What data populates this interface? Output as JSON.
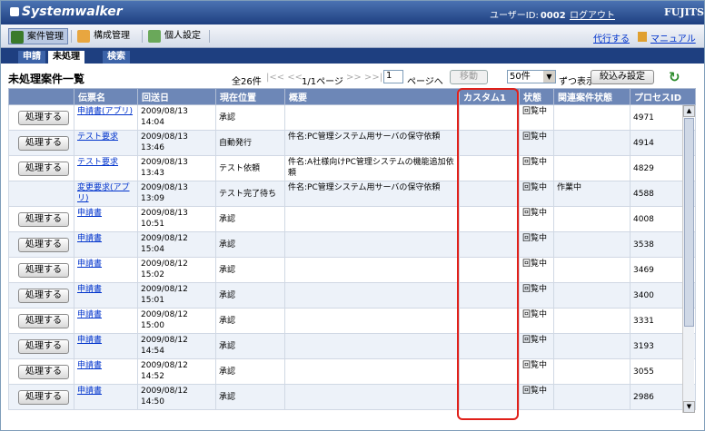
{
  "app": {
    "brand": "Systemwalker",
    "user_label": "ユーザーID:",
    "user_id": "0002",
    "logout": "ログアウト",
    "vendor": "FUJITSU"
  },
  "menu": {
    "case": "案件管理",
    "config": "構成管理",
    "personal": "個人設定",
    "proxy": "代行する",
    "manual": "マニュアル"
  },
  "tabs": {
    "apply": "申請",
    "pending": "未処理",
    "search": "検索"
  },
  "list": {
    "title": "未処理案件一覧",
    "total": "全26件",
    "pager_first": "|<< <<",
    "pageinfo": "1/1ページ",
    "pager_next": ">> >>|",
    "page_value": "1",
    "page_suffix": "ページへ",
    "move": "移動",
    "count": "50件",
    "count_suffix": "ずつ表示",
    "filter": "絞込み設定"
  },
  "columns": [
    "",
    "伝票名",
    "回送日",
    "現在位置",
    "概要",
    "カスタム1",
    "状態",
    "関連案件状態",
    "プロセスID"
  ],
  "rows": [
    {
      "btn": "処理する",
      "slip": "申請書(アプリ)",
      "date": "2009/08/13 14:04",
      "pos": "承認",
      "summary": "",
      "custom": "",
      "status": "回覧中",
      "rel": "",
      "pid": "4971"
    },
    {
      "btn": "処理する",
      "slip": "テスト要求",
      "date": "2009/08/13 13:46",
      "pos": "自動発行",
      "summary": "件名:PC管理システム用サーバの保守依頼",
      "custom": "",
      "status": "回覧中",
      "rel": "",
      "pid": "4914"
    },
    {
      "btn": "処理する",
      "slip": "テスト要求",
      "date": "2009/08/13 13:43",
      "pos": "テスト依頼",
      "summary": "件名:A社様向けPC管理システムの機能追加依頼",
      "custom": "",
      "status": "回覧中",
      "rel": "",
      "pid": "4829"
    },
    {
      "btn": "",
      "slip": "変更要求(アプリ)",
      "date": "2009/08/13 13:09",
      "pos": "テスト完了待ち",
      "summary": "件名:PC管理システム用サーバの保守依頼",
      "custom": "",
      "status": "回覧中",
      "rel": "作業中",
      "pid": "4588"
    },
    {
      "btn": "処理する",
      "slip": "申請書",
      "date": "2009/08/13 10:51",
      "pos": "承認",
      "summary": "",
      "custom": "",
      "status": "回覧中",
      "rel": "",
      "pid": "4008"
    },
    {
      "btn": "処理する",
      "slip": "申請書",
      "date": "2009/08/12 15:04",
      "pos": "承認",
      "summary": "",
      "custom": "",
      "status": "回覧中",
      "rel": "",
      "pid": "3538"
    },
    {
      "btn": "処理する",
      "slip": "申請書",
      "date": "2009/08/12 15:02",
      "pos": "承認",
      "summary": "",
      "custom": "",
      "status": "回覧中",
      "rel": "",
      "pid": "3469"
    },
    {
      "btn": "処理する",
      "slip": "申請書",
      "date": "2009/08/12 15:01",
      "pos": "承認",
      "summary": "",
      "custom": "",
      "status": "回覧中",
      "rel": "",
      "pid": "3400"
    },
    {
      "btn": "処理する",
      "slip": "申請書",
      "date": "2009/08/12 15:00",
      "pos": "承認",
      "summary": "",
      "custom": "",
      "status": "回覧中",
      "rel": "",
      "pid": "3331"
    },
    {
      "btn": "処理する",
      "slip": "申請書",
      "date": "2009/08/12 14:54",
      "pos": "承認",
      "summary": "",
      "custom": "",
      "status": "回覧中",
      "rel": "",
      "pid": "3193"
    },
    {
      "btn": "処理する",
      "slip": "申請書",
      "date": "2009/08/12 14:52",
      "pos": "承認",
      "summary": "",
      "custom": "",
      "status": "回覧中",
      "rel": "",
      "pid": "3055"
    },
    {
      "btn": "処理する",
      "slip": "申請書",
      "date": "2009/08/12 14:50",
      "pos": "承認",
      "summary": "",
      "custom": "",
      "status": "回覧中",
      "rel": "",
      "pid": "2986"
    }
  ],
  "colors": {
    "header": "#1e3f80",
    "grid_header": "#6d87b7",
    "highlight": "#e0201a"
  }
}
